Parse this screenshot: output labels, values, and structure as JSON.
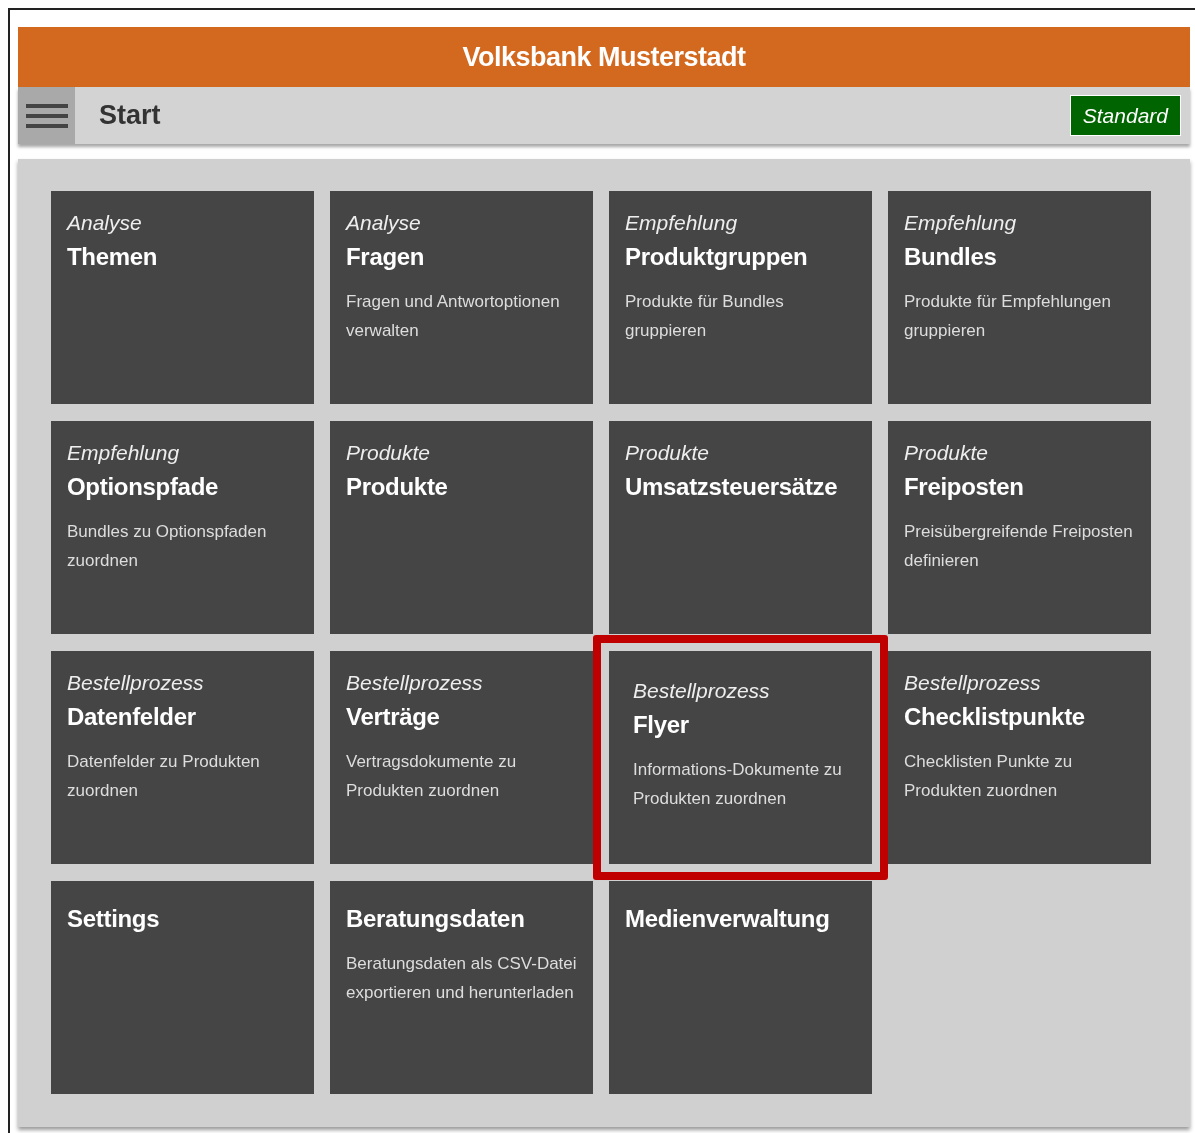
{
  "header": {
    "title": "Volksbank Musterstadt"
  },
  "toolbar": {
    "page_title": "Start",
    "mode_badge": "Standard"
  },
  "tiles": [
    {
      "category": "Analyse",
      "title": "Themen",
      "highlighted": false
    },
    {
      "category": "Analyse",
      "title": "Fragen",
      "description": "Fragen und Antwortoptionen verwalten",
      "highlighted": false
    },
    {
      "category": "Empfehlung",
      "title": "Produktgruppen",
      "description": "Produkte für Bundles gruppieren",
      "highlighted": false
    },
    {
      "category": "Empfehlung",
      "title": "Bundles",
      "description": "Produkte für Empfehlungen gruppieren",
      "highlighted": false
    },
    {
      "category": "Empfehlung",
      "title": "Optionspfade",
      "description": "Bundles zu Optionspfaden zuordnen",
      "highlighted": false
    },
    {
      "category": "Produkte",
      "title": "Produkte",
      "highlighted": false
    },
    {
      "category": "Produkte",
      "title": "Umsatzsteuersätze",
      "highlighted": false
    },
    {
      "category": "Produkte",
      "title": "Freiposten",
      "description": "Preisübergreifende Freiposten definieren",
      "highlighted": false
    },
    {
      "category": "Bestellprozess",
      "title": "Datenfelder",
      "description": "Datenfelder zu Produkten zuordnen",
      "highlighted": false
    },
    {
      "category": "Bestellprozess",
      "title": "Verträge",
      "description": "Vertragsdokumente zu Produkten zuordnen",
      "highlighted": false
    },
    {
      "category": "Bestellprozess",
      "title": "Flyer",
      "description": "Informations-Dokumente zu Produkten zuordnen",
      "highlighted": true
    },
    {
      "category": "Bestellprozess",
      "title": "Checklistpunkte",
      "description": "Checklisten Punkte zu Produkten zuordnen",
      "highlighted": false
    },
    {
      "title": "Settings",
      "highlighted": false
    },
    {
      "title": "Beratungsdaten",
      "description": "Beratungsdaten als CSV-Datei exportieren und herunterladen",
      "highlighted": false
    },
    {
      "title": "Medienverwaltung",
      "highlighted": false
    }
  ]
}
